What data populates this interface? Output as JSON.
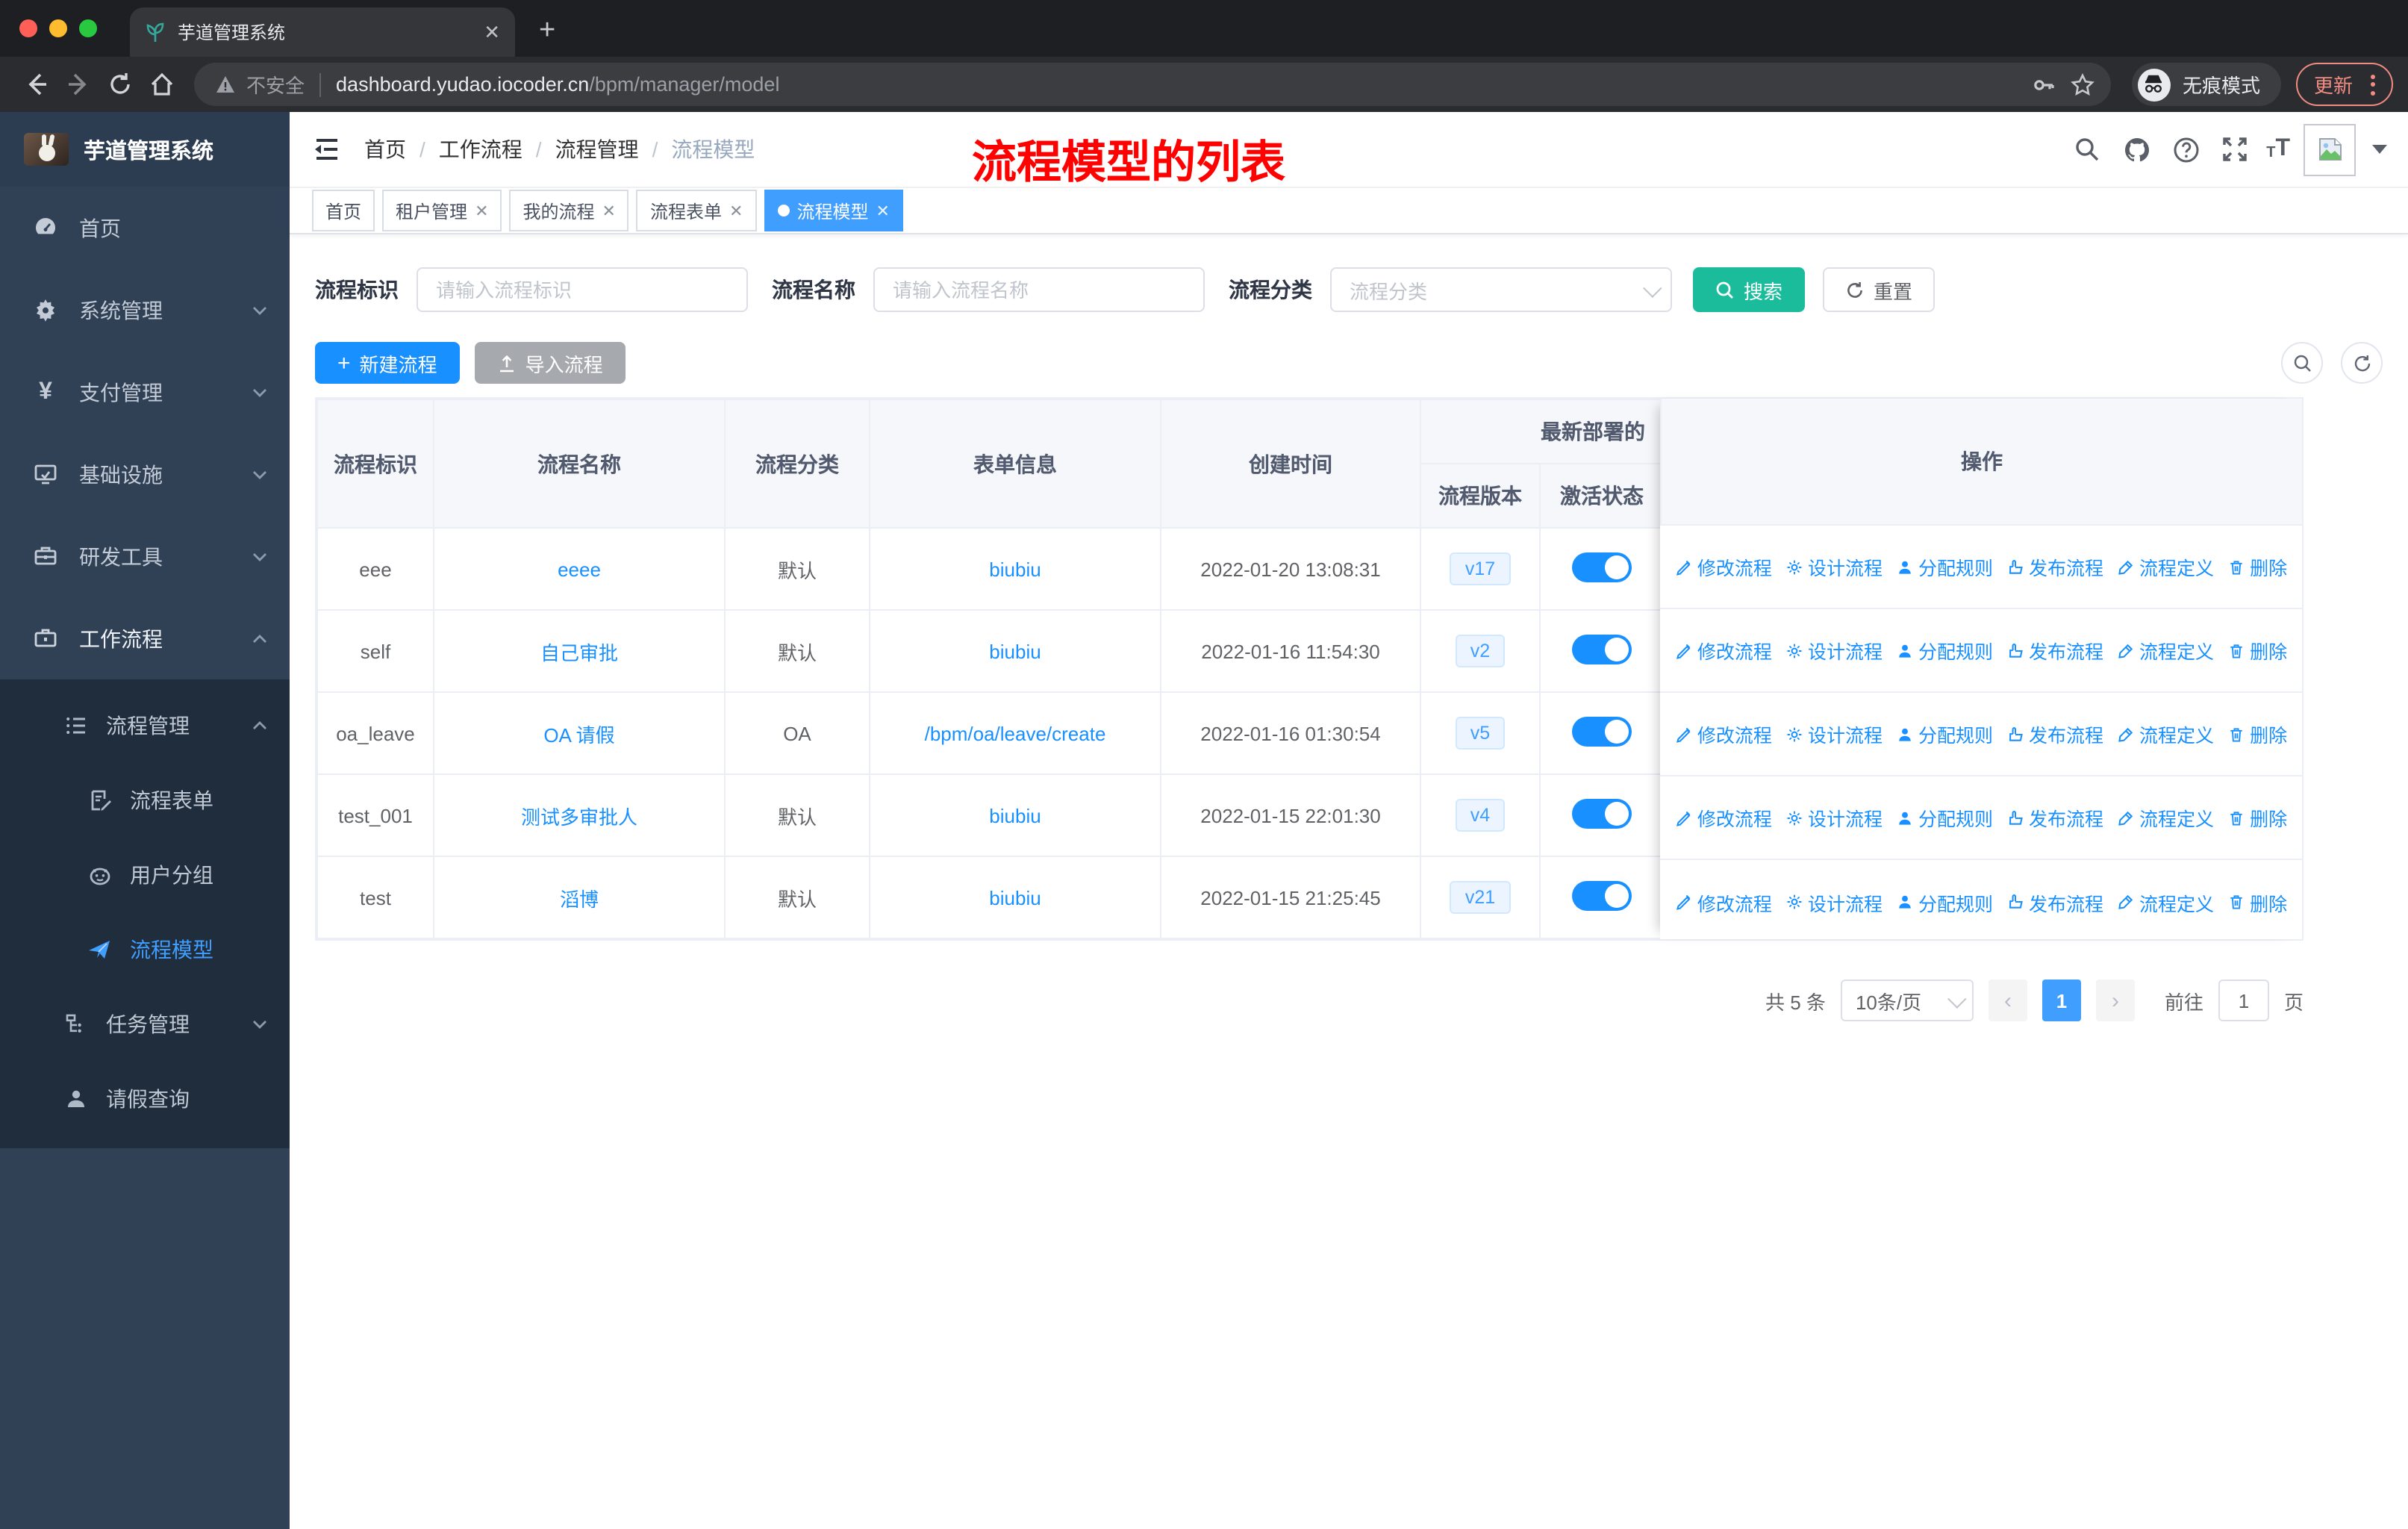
{
  "browser": {
    "tab_title": "芋道管理系统",
    "security_label": "不安全",
    "url_host": "dashboard.yudao.iocoder.cn",
    "url_path": "/bpm/manager/model",
    "incognito_label": "无痕模式",
    "update_label": "更新"
  },
  "annotation": {
    "text": "流程模型的列表",
    "color": "#fe0100"
  },
  "sidebar": {
    "logo_title": "芋道管理系统",
    "items": [
      {
        "label": "首页"
      },
      {
        "label": "系统管理"
      },
      {
        "label": "支付管理"
      },
      {
        "label": "基础设施"
      },
      {
        "label": "研发工具"
      },
      {
        "label": "工作流程"
      }
    ],
    "workflow_children": [
      {
        "label": "流程管理"
      },
      {
        "label": "流程表单"
      },
      {
        "label": "用户分组"
      },
      {
        "label": "流程模型"
      },
      {
        "label": "任务管理"
      },
      {
        "label": "请假查询"
      }
    ]
  },
  "header": {
    "breadcrumb": [
      "首页",
      "工作流程",
      "流程管理",
      "流程模型"
    ]
  },
  "tabs": [
    {
      "label": "首页"
    },
    {
      "label": "租户管理"
    },
    {
      "label": "我的流程"
    },
    {
      "label": "流程表单"
    },
    {
      "label": "流程模型"
    }
  ],
  "filters": {
    "key_label": "流程标识",
    "key_placeholder": "请输入流程标识",
    "name_label": "流程名称",
    "name_placeholder": "请输入流程名称",
    "category_label": "流程分类",
    "category_placeholder": "流程分类",
    "search_label": "搜索",
    "reset_label": "重置"
  },
  "toolbar": {
    "create_label": "新建流程",
    "import_label": "导入流程"
  },
  "table": {
    "columns": [
      "流程标识",
      "流程名称",
      "流程分类",
      "表单信息",
      "创建时间"
    ],
    "group_header": "最新部署的",
    "sub_columns": [
      "流程版本",
      "激活状态"
    ],
    "ops_header": "操作",
    "actions": [
      {
        "label": "修改流程"
      },
      {
        "label": "设计流程"
      },
      {
        "label": "分配规则"
      },
      {
        "label": "发布流程"
      },
      {
        "label": "流程定义"
      },
      {
        "label": "删除"
      }
    ],
    "rows": [
      {
        "id": "eee",
        "name": "eeee",
        "category": "默认",
        "form": "biubiu",
        "created": "2022-01-20 13:08:31",
        "version": "v17"
      },
      {
        "id": "self",
        "name": "自己审批",
        "category": "默认",
        "form": "biubiu",
        "created": "2022-01-16 11:54:30",
        "version": "v2"
      },
      {
        "id": "oa_leave",
        "name": "OA 请假",
        "category": "OA",
        "form": "/bpm/oa/leave/create",
        "created": "2022-01-16 01:30:54",
        "version": "v5"
      },
      {
        "id": "test_001",
        "name": "测试多审批人",
        "category": "默认",
        "form": "biubiu",
        "created": "2022-01-15 22:01:30",
        "version": "v4"
      },
      {
        "id": "test",
        "name": "滔博",
        "category": "默认",
        "form": "biubiu",
        "created": "2022-01-15 21:25:45",
        "version": "v21"
      }
    ]
  },
  "pagination": {
    "total": "共 5 条",
    "page_size": "10条/页",
    "current": "1",
    "goto_label": "前往",
    "goto_value": "1",
    "page_label": "页"
  },
  "colors": {
    "primary_blue": "#1890ff",
    "tab_active_blue": "#409eff",
    "search_teal": "#1abc9c",
    "sidebar_bg": "#304156",
    "submenu_bg": "#1f2d3d",
    "annotation_red": "#fe0100",
    "update_coral": "#f28b82"
  }
}
